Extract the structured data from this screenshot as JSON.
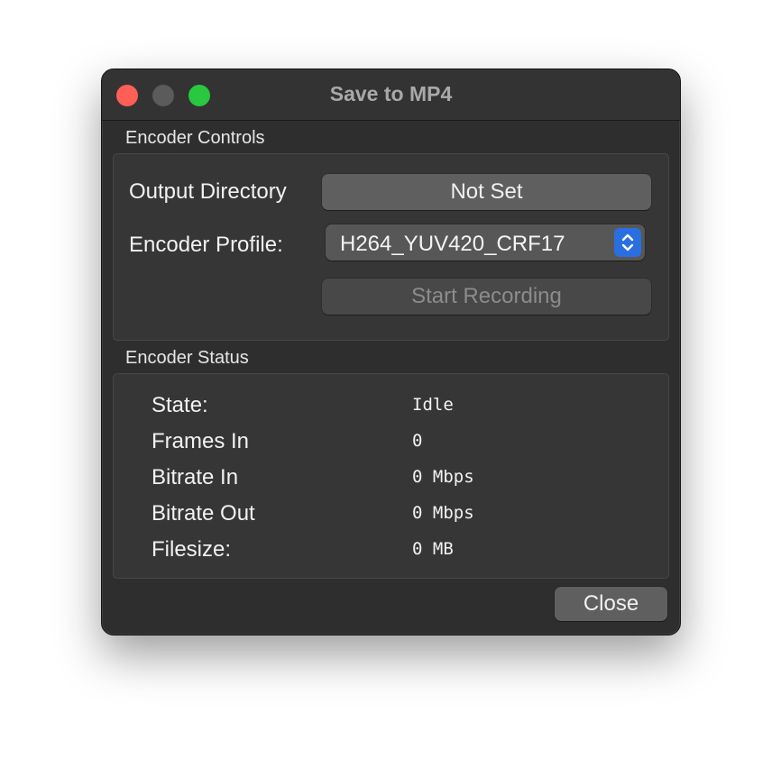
{
  "window": {
    "title": "Save to MP4"
  },
  "encoder_controls": {
    "group_label": "Encoder Controls",
    "output_directory_label": "Output Directory",
    "output_directory_button": "Not Set",
    "encoder_profile_label": "Encoder Profile:",
    "encoder_profile_value": "H264_YUV420_CRF17",
    "start_recording_button": "Start Recording"
  },
  "encoder_status": {
    "group_label": "Encoder Status",
    "rows": [
      {
        "label": "State:",
        "value": "Idle"
      },
      {
        "label": "Frames In",
        "value": "0"
      },
      {
        "label": "Bitrate In",
        "value": "0 Mbps"
      },
      {
        "label": "Bitrate Out",
        "value": "0 Mbps"
      },
      {
        "label": "Filesize:",
        "value": "0 MB"
      }
    ]
  },
  "footer": {
    "close_button": "Close"
  },
  "icons": {
    "traffic_lights": [
      "close-icon",
      "minimize-icon",
      "zoom-icon"
    ],
    "select_arrows": "chevron-up-down-icon"
  },
  "colors": {
    "close_light": "#fe5f57",
    "minimize_light": "#5b5b5b",
    "zoom_light": "#28c840",
    "accent": "#2a6fe0"
  }
}
